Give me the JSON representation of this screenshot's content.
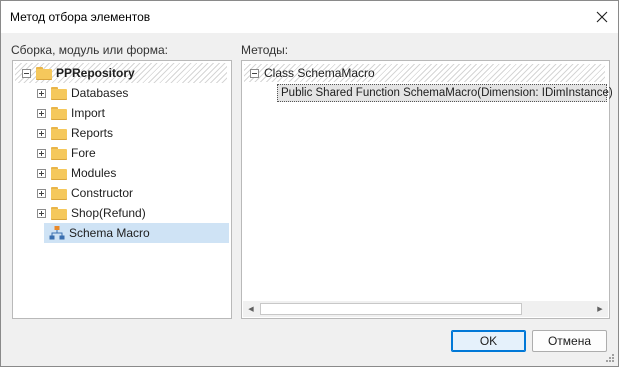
{
  "dialog": {
    "title": "Метод отбора элементов"
  },
  "left_panel": {
    "label": "Сборка, модуль или форма:",
    "root": {
      "label": "PPRepository",
      "icon": "folder-icon"
    },
    "items": [
      {
        "label": "Databases",
        "icon": "folder-icon",
        "expandable": true
      },
      {
        "label": "Import",
        "icon": "folder-icon",
        "expandable": true
      },
      {
        "label": "Reports",
        "icon": "folder-icon",
        "expandable": true
      },
      {
        "label": "Fore",
        "icon": "folder-icon",
        "expandable": true
      },
      {
        "label": "Modules",
        "icon": "folder-icon",
        "expandable": true
      },
      {
        "label": "Constructor",
        "icon": "folder-icon",
        "expandable": true
      },
      {
        "label": "Shop(Refund)",
        "icon": "folder-icon",
        "expandable": true
      },
      {
        "label": "Schema Macro",
        "icon": "schema-icon",
        "expandable": false,
        "selected": true
      }
    ]
  },
  "right_panel": {
    "label": "Методы:",
    "class_node": {
      "label": "Class SchemaMacro"
    },
    "method": {
      "label": "Public Shared Function SchemaMacro(Dimension: IDimInstance)"
    }
  },
  "buttons": {
    "ok": "OK",
    "cancel": "Отмена"
  },
  "colors": {
    "selection": "#cfe3f5",
    "default_button_border": "#0078d7",
    "folder": "#f5c85c"
  }
}
